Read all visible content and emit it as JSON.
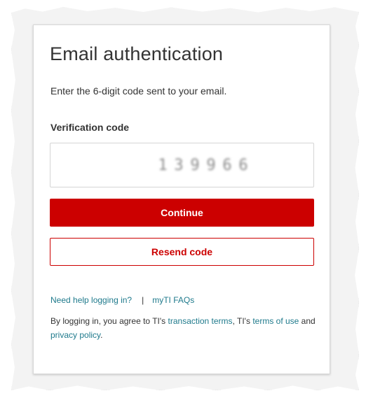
{
  "page": {
    "title": "Email authentication",
    "instructions": "Enter the 6-digit code sent to your email."
  },
  "form": {
    "code_label": "Verification code",
    "code_digits": [
      "1",
      "3",
      "9",
      "9",
      "6",
      "6"
    ],
    "continue_label": "Continue",
    "resend_label": "Resend code"
  },
  "help": {
    "need_help_label": "Need help logging in?",
    "separator": "|",
    "faqs_label": "myTI FAQs"
  },
  "legal": {
    "prefix": "By logging in, you agree to TI's ",
    "transaction_terms": "transaction terms",
    "middle": ", TI's ",
    "terms_of_use": "terms of use",
    "and": " and ",
    "privacy_policy": "privacy policy",
    "suffix": "."
  },
  "colors": {
    "brand_red": "#cc0000",
    "link_teal": "#1f7a8c",
    "text": "#333333"
  }
}
